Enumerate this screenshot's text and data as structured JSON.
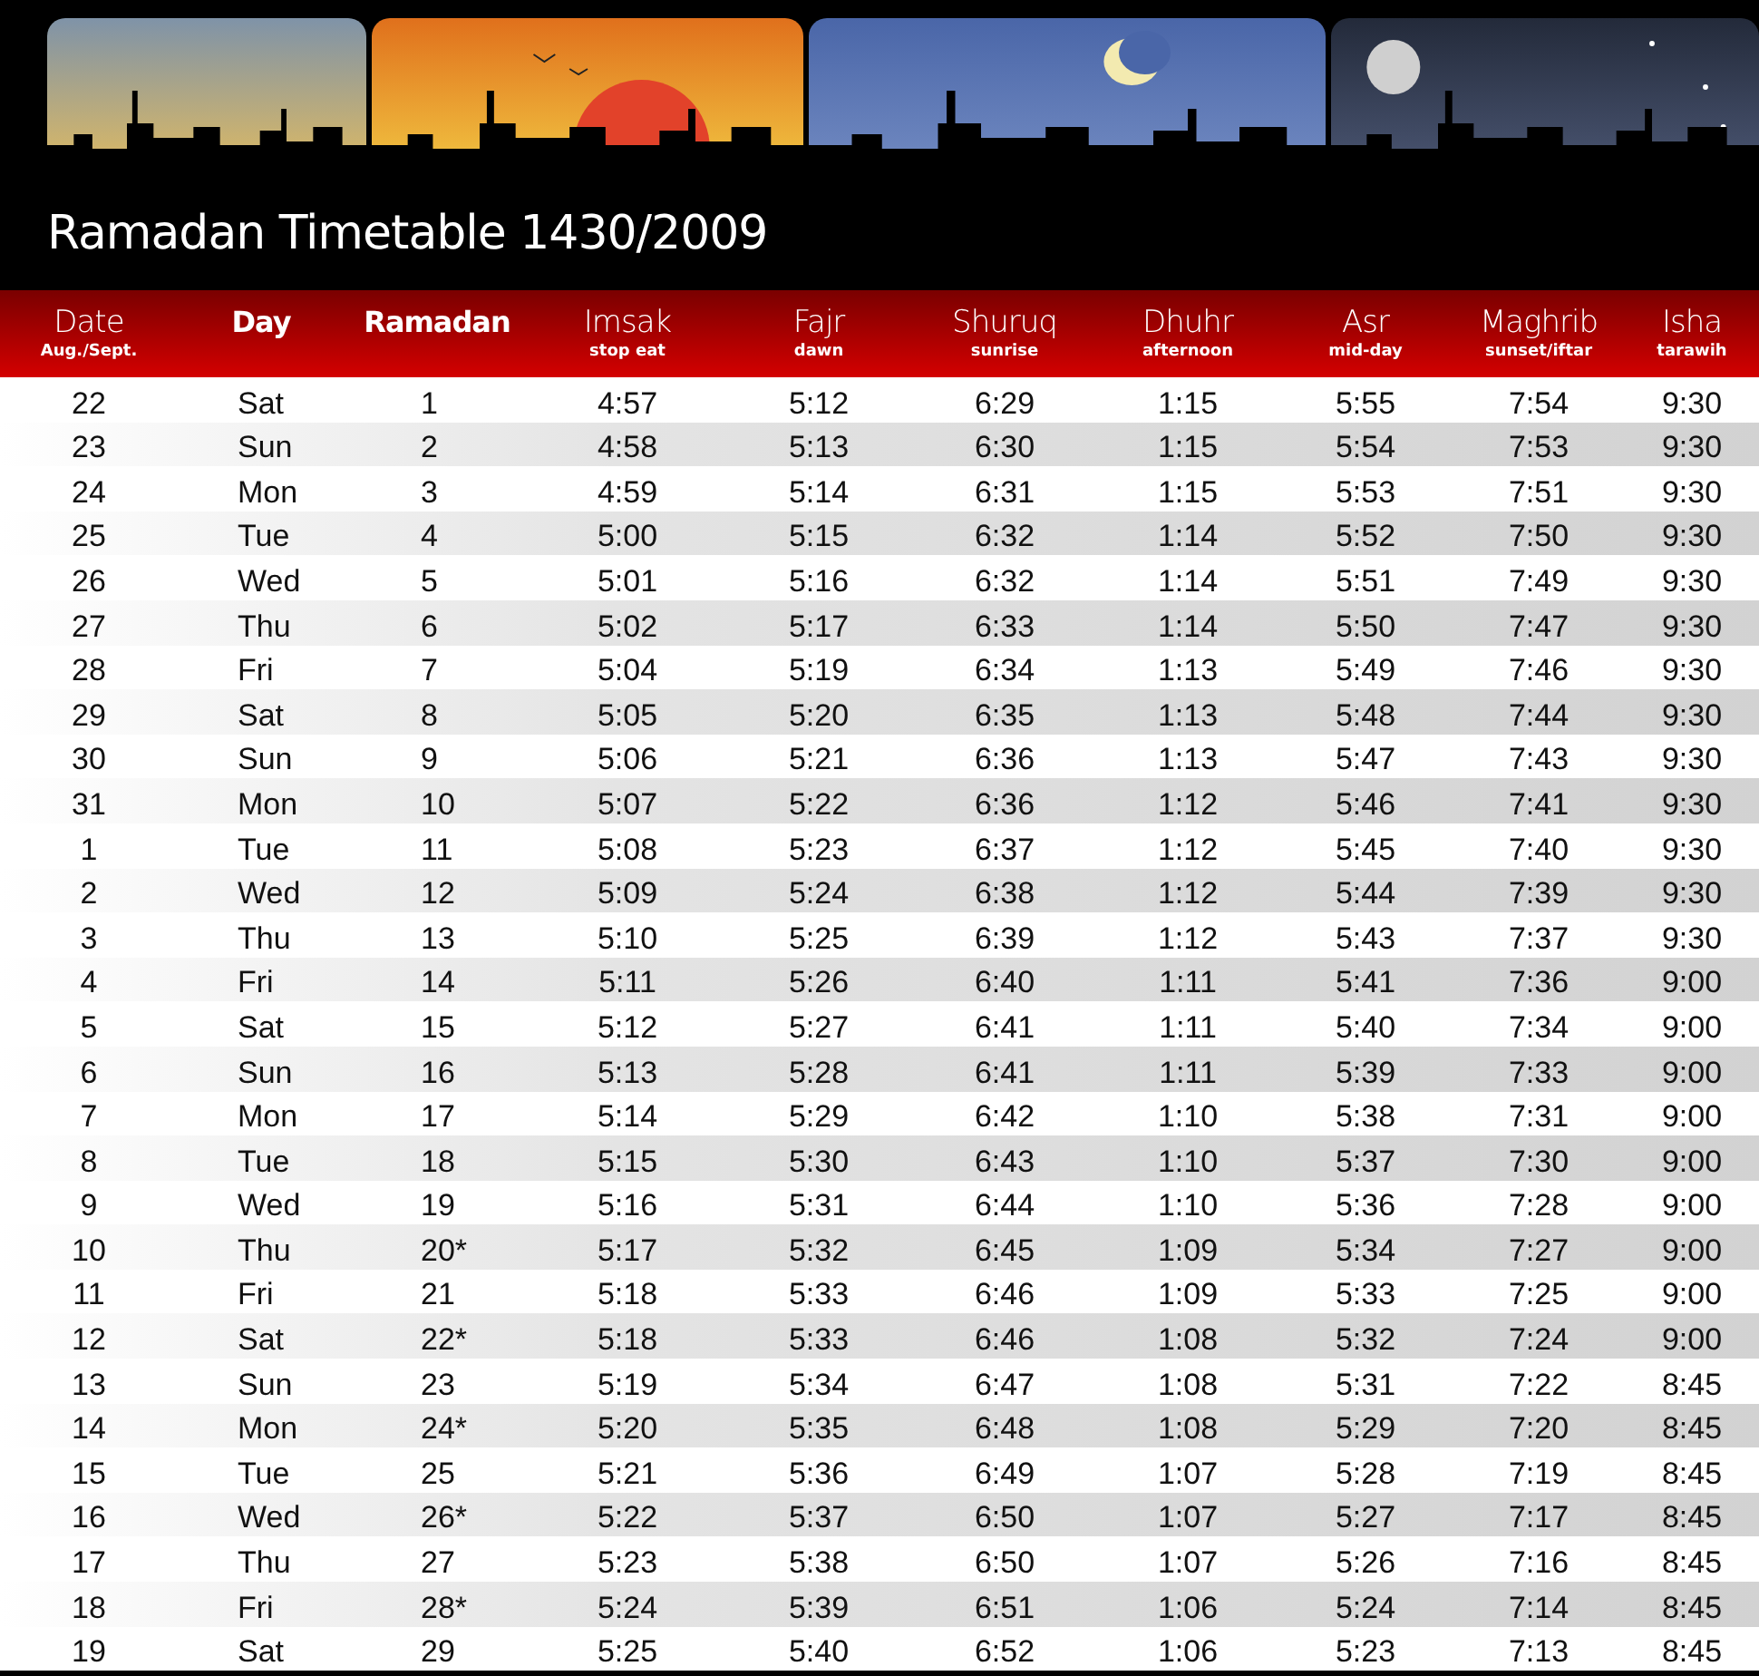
{
  "title": "Ramadan Timetable 1430/2009",
  "columns": [
    {
      "label": "Date",
      "sub": "Aug./Sept.",
      "bold": false
    },
    {
      "label": "Day",
      "bold": true
    },
    {
      "label": "Ramadan",
      "bold": true
    },
    {
      "label": "Imsak",
      "sub": "stop eat",
      "bold": false
    },
    {
      "label": "Fajr",
      "sub": "dawn",
      "bold": false
    },
    {
      "label": "Shuruq",
      "sub": "sunrise",
      "bold": false
    },
    {
      "label": "Dhuhr",
      "sub": "afternoon",
      "bold": false
    },
    {
      "label": "Asr",
      "sub": "mid-day",
      "bold": false
    },
    {
      "label": "Maghrib",
      "sub": "sunset/iftar",
      "bold": false
    },
    {
      "label": "Isha",
      "sub": "tarawih",
      "bold": false
    }
  ],
  "rows": [
    [
      "22",
      "Sat",
      "1",
      "4:57",
      "5:12",
      "6:29",
      "1:15",
      "5:55",
      "7:54",
      "9:30"
    ],
    [
      "23",
      "Sun",
      "2",
      "4:58",
      "5:13",
      "6:30",
      "1:15",
      "5:54",
      "7:53",
      "9:30"
    ],
    [
      "24",
      "Mon",
      "3",
      "4:59",
      "5:14",
      "6:31",
      "1:15",
      "5:53",
      "7:51",
      "9:30"
    ],
    [
      "25",
      "Tue",
      "4",
      "5:00",
      "5:15",
      "6:32",
      "1:14",
      "5:52",
      "7:50",
      "9:30"
    ],
    [
      "26",
      "Wed",
      "5",
      "5:01",
      "5:16",
      "6:32",
      "1:14",
      "5:51",
      "7:49",
      "9:30"
    ],
    [
      "27",
      "Thu",
      "6",
      "5:02",
      "5:17",
      "6:33",
      "1:14",
      "5:50",
      "7:47",
      "9:30"
    ],
    [
      "28",
      "Fri",
      "7",
      "5:04",
      "5:19",
      "6:34",
      "1:13",
      "5:49",
      "7:46",
      "9:30"
    ],
    [
      "29",
      "Sat",
      "8",
      "5:05",
      "5:20",
      "6:35",
      "1:13",
      "5:48",
      "7:44",
      "9:30"
    ],
    [
      "30",
      "Sun",
      "9",
      "5:06",
      "5:21",
      "6:36",
      "1:13",
      "5:47",
      "7:43",
      "9:30"
    ],
    [
      "31",
      "Mon",
      "10",
      "5:07",
      "5:22",
      "6:36",
      "1:12",
      "5:46",
      "7:41",
      "9:30"
    ],
    [
      "1",
      "Tue",
      "11",
      "5:08",
      "5:23",
      "6:37",
      "1:12",
      "5:45",
      "7:40",
      "9:30"
    ],
    [
      "2",
      "Wed",
      "12",
      "5:09",
      "5:24",
      "6:38",
      "1:12",
      "5:44",
      "7:39",
      "9:30"
    ],
    [
      "3",
      "Thu",
      "13",
      "5:10",
      "5:25",
      "6:39",
      "1:12",
      "5:43",
      "7:37",
      "9:30"
    ],
    [
      "4",
      "Fri",
      "14",
      "5:11",
      "5:26",
      "6:40",
      "1:11",
      "5:41",
      "7:36",
      "9:00"
    ],
    [
      "5",
      "Sat",
      "15",
      "5:12",
      "5:27",
      "6:41",
      "1:11",
      "5:40",
      "7:34",
      "9:00"
    ],
    [
      "6",
      "Sun",
      "16",
      "5:13",
      "5:28",
      "6:41",
      "1:11",
      "5:39",
      "7:33",
      "9:00"
    ],
    [
      "7",
      "Mon",
      "17",
      "5:14",
      "5:29",
      "6:42",
      "1:10",
      "5:38",
      "7:31",
      "9:00"
    ],
    [
      "8",
      "Tue",
      "18",
      "5:15",
      "5:30",
      "6:43",
      "1:10",
      "5:37",
      "7:30",
      "9:00"
    ],
    [
      "9",
      "Wed",
      "19",
      "5:16",
      "5:31",
      "6:44",
      "1:10",
      "5:36",
      "7:28",
      "9:00"
    ],
    [
      "10",
      "Thu",
      "20*",
      "5:17",
      "5:32",
      "6:45",
      "1:09",
      "5:34",
      "7:27",
      "9:00"
    ],
    [
      "11",
      "Fri",
      "21",
      "5:18",
      "5:33",
      "6:46",
      "1:09",
      "5:33",
      "7:25",
      "9:00"
    ],
    [
      "12",
      "Sat",
      "22*",
      "5:18",
      "5:33",
      "6:46",
      "1:08",
      "5:32",
      "7:24",
      "9:00"
    ],
    [
      "13",
      "Sun",
      "23",
      "5:19",
      "5:34",
      "6:47",
      "1:08",
      "5:31",
      "7:22",
      "8:45"
    ],
    [
      "14",
      "Mon",
      "24*",
      "5:20",
      "5:35",
      "6:48",
      "1:08",
      "5:29",
      "7:20",
      "8:45"
    ],
    [
      "15",
      "Tue",
      "25",
      "5:21",
      "5:36",
      "6:49",
      "1:07",
      "5:28",
      "7:19",
      "8:45"
    ],
    [
      "16",
      "Wed",
      "26*",
      "5:22",
      "5:37",
      "6:50",
      "1:07",
      "5:27",
      "7:17",
      "8:45"
    ],
    [
      "17",
      "Thu",
      "27",
      "5:23",
      "5:38",
      "6:50",
      "1:07",
      "5:26",
      "7:16",
      "8:45"
    ],
    [
      "18",
      "Fri",
      "28*",
      "5:24",
      "5:39",
      "6:51",
      "1:06",
      "5:24",
      "7:14",
      "8:45"
    ],
    [
      "19",
      "Sat",
      "29",
      "5:25",
      "5:40",
      "6:52",
      "1:06",
      "5:23",
      "7:13",
      "8:45"
    ]
  ]
}
